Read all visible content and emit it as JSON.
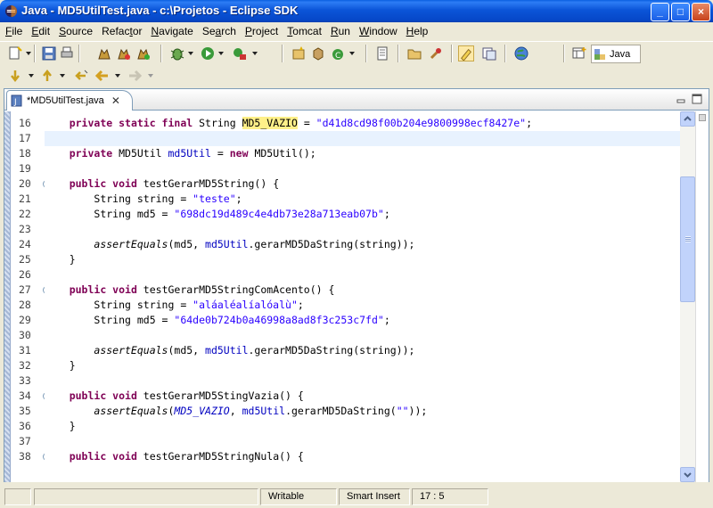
{
  "window": {
    "title": "Java - MD5UtilTest.java - c:\\Projetos - Eclipse SDK",
    "controls": {
      "minimize": "_",
      "maximize": "□",
      "close": "×"
    }
  },
  "menu": [
    {
      "mnemonic": "F",
      "rest": "ile"
    },
    {
      "mnemonic": "E",
      "rest": "dit"
    },
    {
      "mnemonic": "S",
      "rest": "ource"
    },
    {
      "pre": "Refac",
      "mnemonic": "t",
      "rest": "or"
    },
    {
      "mnemonic": "N",
      "rest": "avigate"
    },
    {
      "pre": "Se",
      "mnemonic": "a",
      "rest": "rch"
    },
    {
      "mnemonic": "P",
      "rest": "roject"
    },
    {
      "mnemonic": "T",
      "rest": "omcat"
    },
    {
      "mnemonic": "R",
      "rest": "un"
    },
    {
      "mnemonic": "W",
      "rest": "indow"
    },
    {
      "mnemonic": "H",
      "rest": "elp"
    }
  ],
  "perspective": {
    "label": "Java"
  },
  "editor": {
    "tab_label": "*MD5UtilTest.java",
    "tab_close": "✕",
    "current_line": 17,
    "lines": [
      {
        "n": "16",
        "fold": false,
        "tokens": [
          [
            "i",
            "    "
          ],
          [
            "kw",
            "private static final"
          ],
          [
            "p",
            " String "
          ],
          [
            "hl",
            "MD5_VAZIO"
          ],
          [
            "p",
            " = "
          ],
          [
            "str",
            "\"d41d8cd98f00b204e9800998ecf8427e\""
          ],
          [
            "p",
            ";"
          ]
        ]
      },
      {
        "n": "17",
        "fold": false,
        "tokens": []
      },
      {
        "n": "18",
        "fold": false,
        "tokens": [
          [
            "i",
            "    "
          ],
          [
            "kw",
            "private"
          ],
          [
            "p",
            " MD5Util "
          ],
          [
            "fld",
            "md5Util"
          ],
          [
            "p",
            " = "
          ],
          [
            "kw",
            "new"
          ],
          [
            "p",
            " MD5Util();"
          ]
        ]
      },
      {
        "n": "19",
        "fold": false,
        "tokens": []
      },
      {
        "n": "20",
        "fold": true,
        "tokens": [
          [
            "i",
            "    "
          ],
          [
            "kw",
            "public void"
          ],
          [
            "p",
            " testGerarMD5String() {"
          ]
        ]
      },
      {
        "n": "21",
        "fold": false,
        "tokens": [
          [
            "i",
            "        "
          ],
          [
            "p",
            "String string = "
          ],
          [
            "str",
            "\"teste\""
          ],
          [
            "p",
            ";"
          ]
        ]
      },
      {
        "n": "22",
        "fold": false,
        "tokens": [
          [
            "i",
            "        "
          ],
          [
            "p",
            "String md5 = "
          ],
          [
            "str",
            "\"698dc19d489c4e4db73e28a713eab07b\""
          ],
          [
            "p",
            ";"
          ]
        ]
      },
      {
        "n": "23",
        "fold": false,
        "tokens": []
      },
      {
        "n": "24",
        "fold": false,
        "tokens": [
          [
            "i",
            "        "
          ],
          [
            "smeth",
            "assertEquals"
          ],
          [
            "p",
            "(md5, "
          ],
          [
            "fld",
            "md5Util"
          ],
          [
            "p",
            ".gerarMD5DaString(string));"
          ]
        ]
      },
      {
        "n": "25",
        "fold": false,
        "tokens": [
          [
            "i",
            "    "
          ],
          [
            "p",
            "}"
          ]
        ]
      },
      {
        "n": "26",
        "fold": false,
        "tokens": []
      },
      {
        "n": "27",
        "fold": true,
        "tokens": [
          [
            "i",
            "    "
          ],
          [
            "kw",
            "public void"
          ],
          [
            "p",
            " testGerarMD5StringComAcento() {"
          ]
        ]
      },
      {
        "n": "28",
        "fold": false,
        "tokens": [
          [
            "i",
            "        "
          ],
          [
            "p",
            "String string = "
          ],
          [
            "str",
            "\"aláaléalíalóalù\""
          ],
          [
            "p",
            ";"
          ]
        ]
      },
      {
        "n": "29",
        "fold": false,
        "tokens": [
          [
            "i",
            "        "
          ],
          [
            "p",
            "String md5 = "
          ],
          [
            "str",
            "\"64de0b724b0a46998a8ad8f3c253c7fd\""
          ],
          [
            "p",
            ";"
          ]
        ]
      },
      {
        "n": "30",
        "fold": false,
        "tokens": []
      },
      {
        "n": "31",
        "fold": false,
        "tokens": [
          [
            "i",
            "        "
          ],
          [
            "smeth",
            "assertEquals"
          ],
          [
            "p",
            "(md5, "
          ],
          [
            "fld",
            "md5Util"
          ],
          [
            "p",
            ".gerarMD5DaString(string));"
          ]
        ]
      },
      {
        "n": "32",
        "fold": false,
        "tokens": [
          [
            "i",
            "    "
          ],
          [
            "p",
            "}"
          ]
        ]
      },
      {
        "n": "33",
        "fold": false,
        "tokens": []
      },
      {
        "n": "34",
        "fold": true,
        "tokens": [
          [
            "i",
            "    "
          ],
          [
            "kw",
            "public void"
          ],
          [
            "p",
            " testGerarMD5StingVazia() {"
          ]
        ]
      },
      {
        "n": "35",
        "fold": false,
        "tokens": [
          [
            "i",
            "        "
          ],
          [
            "smeth",
            "assertEquals"
          ],
          [
            "p",
            "("
          ],
          [
            "sfld",
            "MD5_VAZIO"
          ],
          [
            "p",
            ", "
          ],
          [
            "fld",
            "md5Util"
          ],
          [
            "p",
            ".gerarMD5DaString("
          ],
          [
            "str",
            "\"\""
          ],
          [
            "p",
            "));"
          ]
        ]
      },
      {
        "n": "36",
        "fold": false,
        "tokens": [
          [
            "i",
            "    "
          ],
          [
            "p",
            "}"
          ]
        ]
      },
      {
        "n": "37",
        "fold": false,
        "tokens": []
      },
      {
        "n": "38",
        "fold": true,
        "tokens": [
          [
            "i",
            "    "
          ],
          [
            "kw",
            "public void"
          ],
          [
            "p",
            " testGerarMD5StringNula() {"
          ]
        ]
      }
    ]
  },
  "status": {
    "writable": "Writable",
    "insert_mode": "Smart Insert",
    "position": "17 : 5"
  },
  "colors": {
    "keyword": "#7f0055",
    "string": "#2a00ff",
    "field": "#0000c0",
    "occurrence_highlight": "#fff089",
    "current_line": "#e8f2fe",
    "titlebar": "#0a55d8"
  }
}
